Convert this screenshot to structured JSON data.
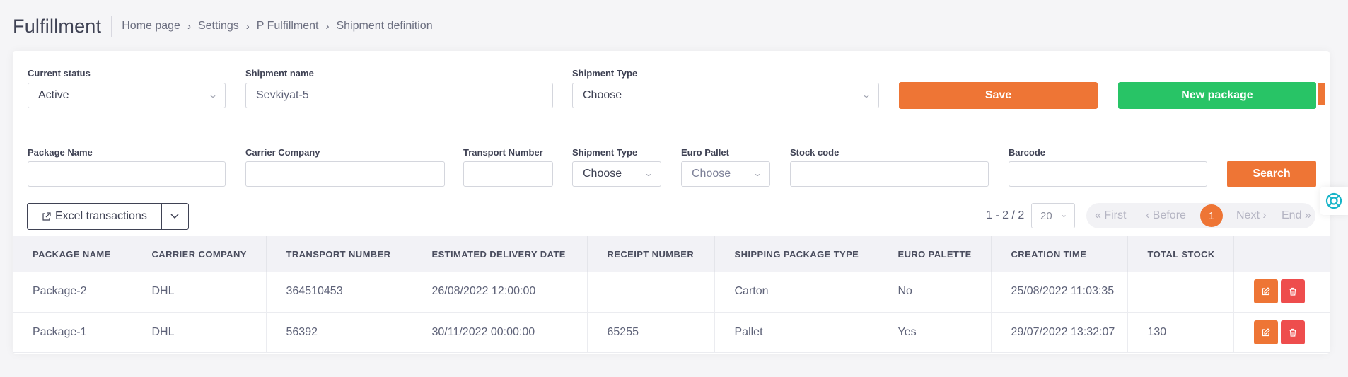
{
  "header": {
    "app_title": "Fulfillment",
    "breadcrumbs": [
      "Home page",
      "Settings",
      "P Fulfillment",
      "Shipment definition"
    ]
  },
  "form": {
    "current_status_label": "Current status",
    "current_status_value": "Active",
    "shipment_name_label": "Shipment name",
    "shipment_name_value": "Sevkiyat-5",
    "shipment_type_label": "Shipment Type",
    "shipment_type_value": "Choose",
    "save_label": "Save",
    "new_package_label": "New package"
  },
  "filters": {
    "package_name_label": "Package Name",
    "carrier_company_label": "Carrier Company",
    "transport_number_label": "Transport Number",
    "shipment_type_label": "Shipment Type",
    "shipment_type_value": "Choose",
    "euro_pallet_label": "Euro Pallet",
    "euro_pallet_value": "Choose",
    "stock_code_label": "Stock code",
    "barcode_label": "Barcode",
    "search_label": "Search"
  },
  "toolbar": {
    "excel_label": "Excel transactions",
    "range_text": "1 - 2 / 2",
    "page_size": "20",
    "pager": {
      "first": "« First",
      "before": "‹ Before",
      "current": "1",
      "next": "Next ›",
      "end": "End »"
    }
  },
  "table": {
    "columns": [
      "PACKAGE NAME",
      "CARRIER COMPANY",
      "TRANSPORT NUMBER",
      "ESTIMATED DELIVERY DATE",
      "RECEIPT NUMBER",
      "SHIPPING PACKAGE TYPE",
      "EURO PALETTE",
      "CREATION TIME",
      "TOTAL STOCK"
    ],
    "rows": [
      [
        "Package-2",
        "DHL",
        "364510453",
        "26/08/2022 12:00:00",
        "",
        "Carton",
        "No",
        "25/08/2022 11:03:35",
        ""
      ],
      [
        "Package-1",
        "DHL",
        "56392",
        "30/11/2022 00:00:00",
        "65255",
        "Pallet",
        "Yes",
        "29/07/2022 13:32:07",
        "130"
      ]
    ]
  },
  "colors": {
    "accent_orange": "#ee7535",
    "accent_green": "#28c466",
    "danger_red": "#ee4d4d",
    "help_teal": "#17b4c8"
  },
  "icons": [
    "external-link-icon",
    "chevron-down-icon",
    "edit-icon",
    "trash-icon",
    "lifebuoy-icon"
  ]
}
